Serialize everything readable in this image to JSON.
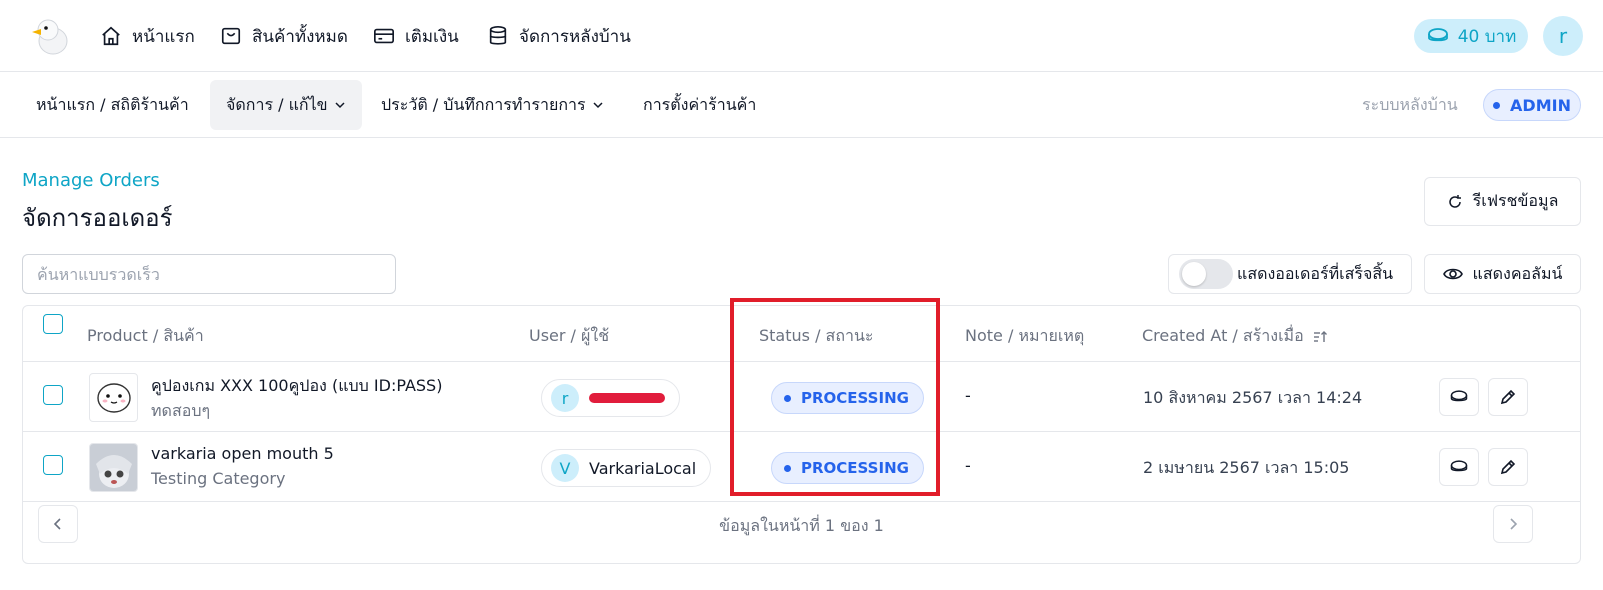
{
  "topnav": {
    "items": [
      {
        "label": "หน้าแรก",
        "icon": "home-icon"
      },
      {
        "label": "สินค้าทั้งหมด",
        "icon": "shopping-bag-icon"
      },
      {
        "label": "เติมเงิน",
        "icon": "credit-card-icon"
      },
      {
        "label": "จัดการหลังบ้าน",
        "icon": "database-icon"
      }
    ],
    "balance": "40 บาท",
    "user_initial": "r"
  },
  "subnav": {
    "items": [
      {
        "label": "หน้าแรก / สถิติร้านค้า"
      },
      {
        "label": "จัดการ / แก้ไข"
      },
      {
        "label": "ประวัติ / บันทึกการทำรายการ"
      },
      {
        "label": "การตั้งค่าร้านค้า"
      }
    ],
    "backend_label": "ระบบหลังบ้าน",
    "role_badge": "ADMIN"
  },
  "page": {
    "eyebrow": "Manage Orders",
    "title": "จัดการออเดอร์",
    "refresh_label": "รีเฟรชข้อมูล",
    "search_placeholder": "ค้นหาแบบรวดเร็ว",
    "show_completed_label": "แสดงออเดอร์ที่เสร็จสิ้น",
    "show_completed_on": false,
    "show_columns_label": "แสดงคอลัมน์"
  },
  "table": {
    "headers": {
      "product": "Product / สินค้า",
      "user": "User / ผู้ใช้",
      "status": "Status / สถานะ",
      "note": "Note / หมายเหตุ",
      "created": "Created At / สร้างเมื่อ"
    },
    "rows": [
      {
        "product_name": "คูปองเกม XXX 100คูปอง (แบบ ID:PASS)",
        "category": "ทดสอบๆ",
        "user_initial": "r",
        "user_name": "",
        "status": "PROCESSING",
        "note": "-",
        "created": "10 สิงหาคม 2567 เวลา 14:24"
      },
      {
        "product_name": "varkaria open mouth 5",
        "category": "Testing Category",
        "user_initial": "V",
        "user_name": "VarkariaLocal",
        "status": "PROCESSING",
        "note": "-",
        "created": "2 เมษายน 2567 เวลา 15:05"
      }
    ],
    "pagination_text": "ข้อมูลในหน้าที่ 1 ของ 1"
  },
  "colors": {
    "accent": "#0ea5c6",
    "status_blue": "#2563eb",
    "highlight": "#e11d2a"
  }
}
